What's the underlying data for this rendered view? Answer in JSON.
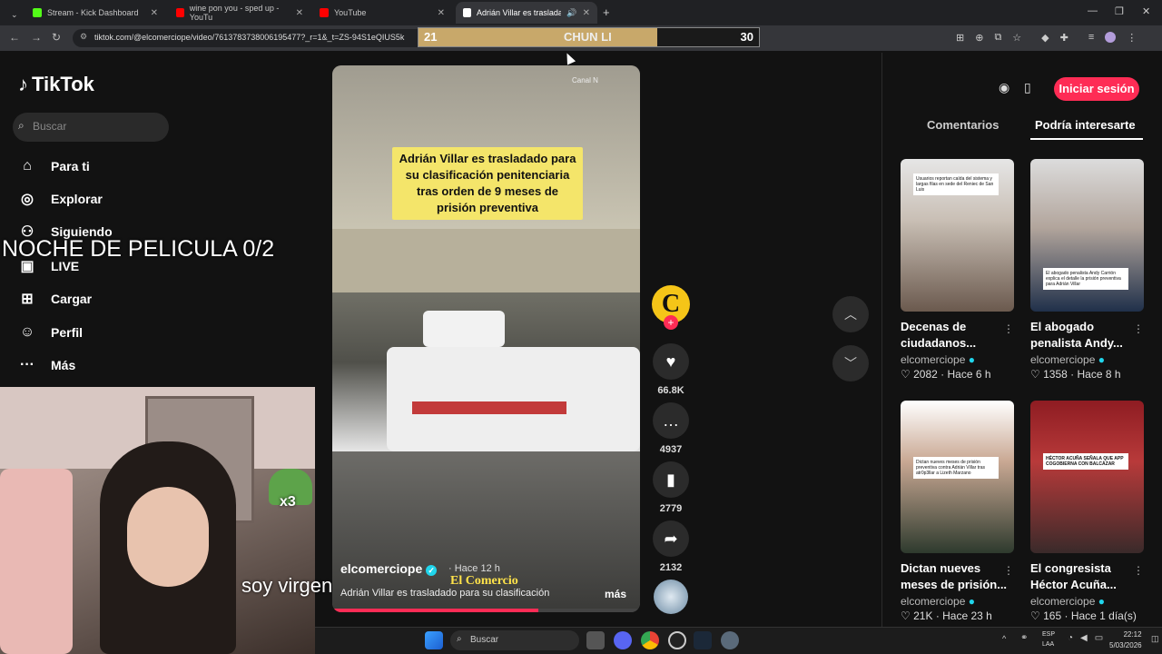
{
  "browser": {
    "tabs": [
      {
        "title": "Stream - Kick Dashboard",
        "icon": "kick-icon",
        "color": "#53fc18"
      },
      {
        "title": "wine pon you - sped up - YouTu",
        "icon": "youtube-icon",
        "color": "#ff0000"
      },
      {
        "title": "YouTube",
        "icon": "youtube-icon",
        "color": "#ff0000"
      },
      {
        "title": "Adrián Villar es trasladado",
        "icon": "tiktok-icon",
        "color": "#ffffff"
      }
    ],
    "url": "tiktok.com/@elcomerciope/video/7613783738006195477?_r=1&_t=ZS-94S1eQIUS5k"
  },
  "score_overlay": {
    "left": "21",
    "name": "CHUN LI",
    "right": "30",
    "fill_fraction": 0.7
  },
  "sidebar": {
    "logo": "TikTok",
    "search_placeholder": "Buscar",
    "items": [
      {
        "label": "Para ti",
        "icon": "home-icon"
      },
      {
        "label": "Explorar",
        "icon": "compass-icon"
      },
      {
        "label": "Siguiendo",
        "icon": "following-icon"
      },
      {
        "label": "LIVE",
        "icon": "live-icon"
      },
      {
        "label": "Cargar",
        "icon": "upload-icon"
      },
      {
        "label": "Perfil",
        "icon": "profile-icon"
      },
      {
        "label": "Más",
        "icon": "more-icon"
      }
    ]
  },
  "stream_overlay": {
    "title": "NOCHE DE PELICULA 0/2",
    "webcam_text": "soy virgen",
    "emote_count": "x3"
  },
  "video": {
    "headline": "Adrián Villar es trasladado para su clasificación penitenciaria tras orden de 9 meses de prisión preventiva",
    "watermark": "Canal N",
    "author": "elcomerciope",
    "time": "· Hace 12 h",
    "brand": "El Comercio",
    "caption": "Adrián Villar es trasladado para su clasificación",
    "more": "más",
    "progress": 0.67
  },
  "actions": {
    "likes": "66.8K",
    "comments": "4937",
    "saves": "2779",
    "shares": "2132",
    "avatar_letter": "C"
  },
  "right_panel": {
    "login": "Iniciar sesión",
    "tabs": [
      "Comentarios",
      "Podría interesarte"
    ],
    "cards": [
      {
        "title1": "Decenas de",
        "title2": "ciudadanos...",
        "author": "elcomerciope",
        "likes": "2082",
        "time": "· Hace 6 h",
        "caption": "Usuarios reportan caída del sistema y largas filas en sede del Reniec de San Luis"
      },
      {
        "title1": "El abogado",
        "title2": "penalista Andy...",
        "author": "elcomerciope",
        "likes": "1358",
        "time": "· Hace 8 h",
        "caption": "El abogado penalista Andy Carrión explica el detalle la prisión preventiva para Adrián Villar"
      },
      {
        "title1": "Dictan nueves",
        "title2": "meses de prisión...",
        "author": "elcomerciope",
        "likes": "21K",
        "time": "· Hace 23 h",
        "caption": "Dictan nueves meses de prisión preventiva contra Adrián Villar tras atr0p3llar a Lizeth Marzano"
      },
      {
        "title1": "El congresista",
        "title2": "Héctor Acuña...",
        "author": "elcomerciope",
        "likes": "165",
        "time": "· Hace 1 día(s)",
        "caption": "HÉCTOR ACUÑA SEÑALA QUE APP COGOBIERNA CON BALCÁZAR"
      }
    ]
  },
  "taskbar": {
    "search": "Buscar",
    "lang1": "ESP",
    "lang2": "LAA",
    "time": "22:12",
    "date": "5/03/2026"
  }
}
